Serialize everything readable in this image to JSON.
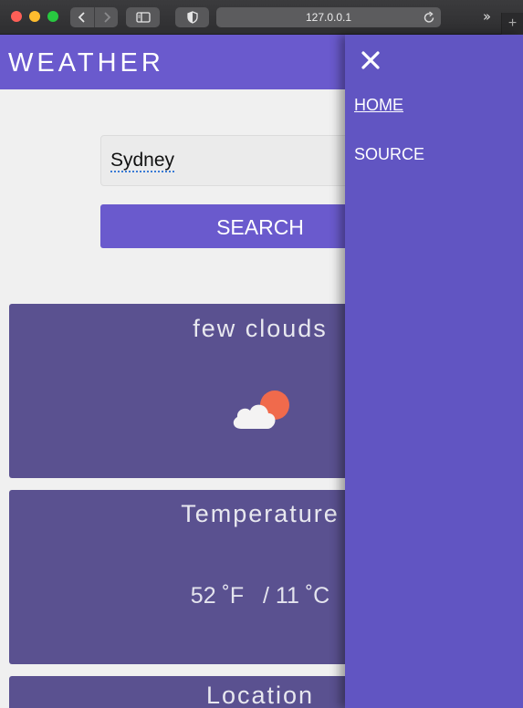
{
  "browser": {
    "url": "127.0.0.1",
    "icons": [
      "back-icon",
      "forward-icon",
      "sidebar-icon",
      "shield-icon",
      "reload-icon",
      "more-icon",
      "new-tab-icon"
    ]
  },
  "header": {
    "title": "WEATHER"
  },
  "search": {
    "value": "Sydney",
    "button_label": "SEARCH"
  },
  "cards": {
    "condition": {
      "title": "few clouds",
      "icon": "partly-cloudy-icon"
    },
    "temperature": {
      "title": "Temperature",
      "fahrenheit": "52 ˚F",
      "separator": "/",
      "celsius": "11 ˚C"
    },
    "location": {
      "title": "Location"
    }
  },
  "drawer": {
    "close_label": "✕",
    "items": [
      {
        "label": "HOME"
      },
      {
        "label": "SOURCE"
      }
    ]
  },
  "colors": {
    "accent": "#6a5acd",
    "drawer": "#6155c2",
    "card": "#5a5190",
    "sun": "#f06a4c"
  }
}
